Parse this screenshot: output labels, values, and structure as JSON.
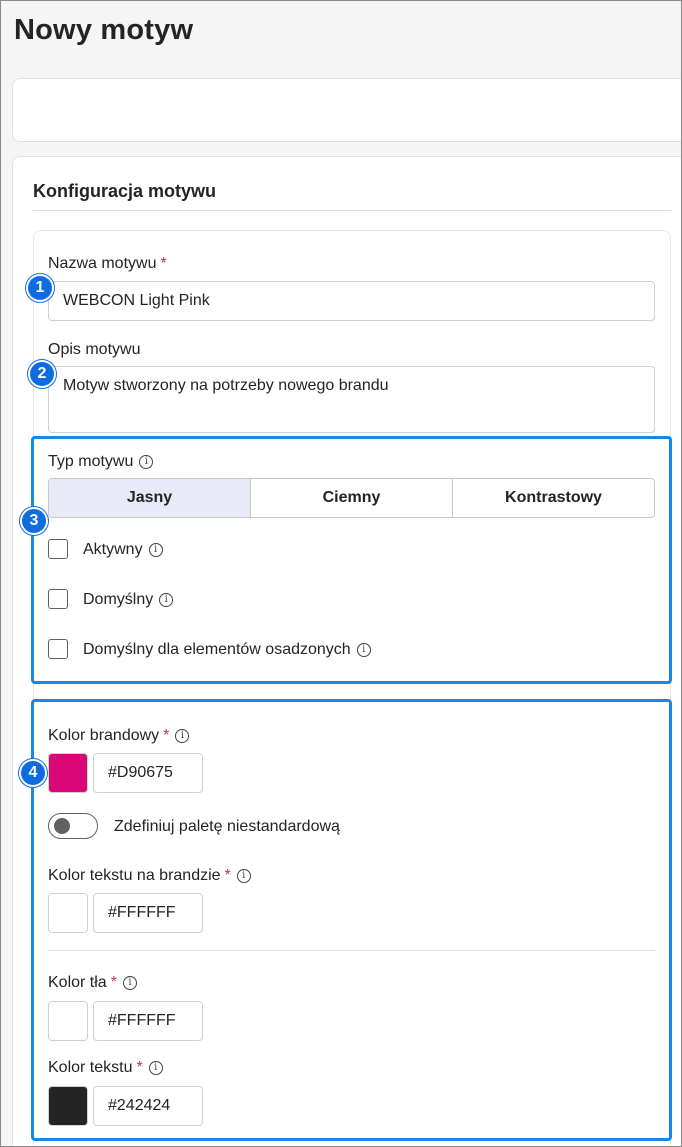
{
  "page": {
    "title": "Nowy motyw"
  },
  "section": {
    "title": "Konfiguracja motywu"
  },
  "name_field": {
    "label": "Nazwa motywu",
    "required_mark": "*",
    "value": "WEBCON Light Pink"
  },
  "description_field": {
    "label": "Opis motywu",
    "value": "Motyw stworzony na potrzeby nowego brandu"
  },
  "theme_type": {
    "label": "Typ motywu",
    "options": [
      {
        "label": "Jasny",
        "selected": true
      },
      {
        "label": "Ciemny",
        "selected": false
      },
      {
        "label": "Kontrastowy",
        "selected": false
      }
    ]
  },
  "checkboxes": [
    {
      "label": "Aktywny",
      "checked": false
    },
    {
      "label": "Domyślny",
      "checked": false
    },
    {
      "label": "Domyślny dla elementów osadzonych",
      "checked": false
    }
  ],
  "brand_color": {
    "label": "Kolor brandowy",
    "required_mark": "*",
    "value": "#D90675",
    "swatch": "#D90675"
  },
  "custom_palette": {
    "label": "Zdefiniuj paletę niestandardową",
    "on": false
  },
  "brand_text_color": {
    "label": "Kolor tekstu na brandzie",
    "required_mark": "*",
    "value": "#FFFFFF",
    "swatch": "#FFFFFF"
  },
  "background_color": {
    "label": "Kolor tła",
    "required_mark": "*",
    "value": "#FFFFFF",
    "swatch": "#FFFFFF"
  },
  "text_color": {
    "label": "Kolor tekstu",
    "required_mark": "*",
    "value": "#242424",
    "swatch": "#242424"
  },
  "badges": [
    "1",
    "2",
    "3",
    "4"
  ],
  "info_glyph": "i",
  "colors": {
    "accent": "#0F6CDE",
    "highlight_border": "#1A86E8",
    "required": "#C4314B"
  }
}
